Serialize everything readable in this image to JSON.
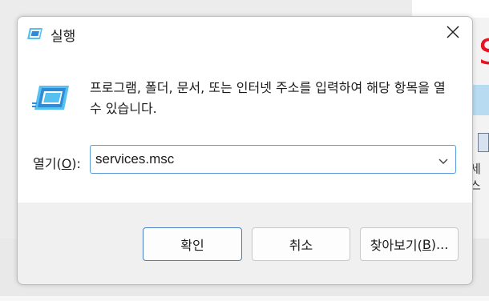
{
  "dialog": {
    "title": "실행",
    "description": "프로그램, 폴더, 문서, 또는 인터넷 주소를 입력하여 해당 항목을 열 수 있습니다.",
    "open_label_prefix": "열기(",
    "open_label_key": "O",
    "open_label_suffix": "):",
    "open_value": "services.msc",
    "buttons": {
      "ok": "확인",
      "cancel": "취소",
      "browse_prefix": "찾아보기(",
      "browse_key": "B",
      "browse_suffix": ")..."
    }
  },
  "background": {
    "red_letter": "S",
    "fragment_circle": "?",
    "fragment_text": "세스"
  },
  "icons": {
    "title": "run-icon",
    "close": "close-icon",
    "content": "run-icon",
    "dropdown": "chevron-down-icon"
  },
  "colors": {
    "accent": "#4a7fc1",
    "icon_blue": "#2f8ad8",
    "icon_cyan": "#56c1f0",
    "red": "#e81123"
  }
}
